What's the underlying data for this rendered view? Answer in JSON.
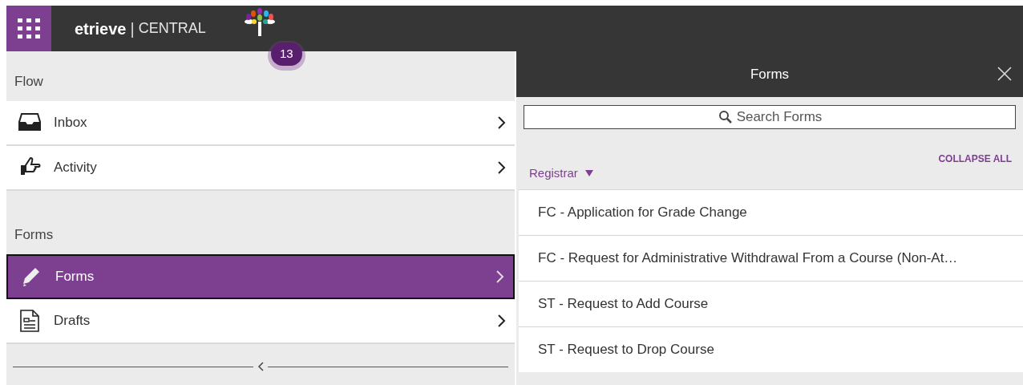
{
  "header": {
    "brand": "etrieve",
    "separator": "|",
    "product": "CENTRAL",
    "badge": "13"
  },
  "sidebar": {
    "sections": [
      {
        "title": "Flow",
        "items": [
          {
            "label": "Inbox",
            "kind": "inbox",
            "selected": false
          },
          {
            "label": "Activity",
            "kind": "activity",
            "selected": false
          }
        ]
      },
      {
        "title": "Forms",
        "items": [
          {
            "label": "Forms",
            "kind": "forms",
            "selected": true
          },
          {
            "label": "Drafts",
            "kind": "drafts",
            "selected": false
          }
        ]
      }
    ]
  },
  "panel": {
    "title": "Forms",
    "search": {
      "placeholder": "Search Forms"
    },
    "collapse_all": "COLLAPSE ALL",
    "group": {
      "label": "Registrar",
      "expanded": true,
      "items": [
        "FC - Application for Grade Change",
        "FC - Request for Administrative Withdrawal From a Course (Non-At…",
        "ST - Request to Add Course",
        "ST - Request to Drop Course"
      ]
    }
  }
}
